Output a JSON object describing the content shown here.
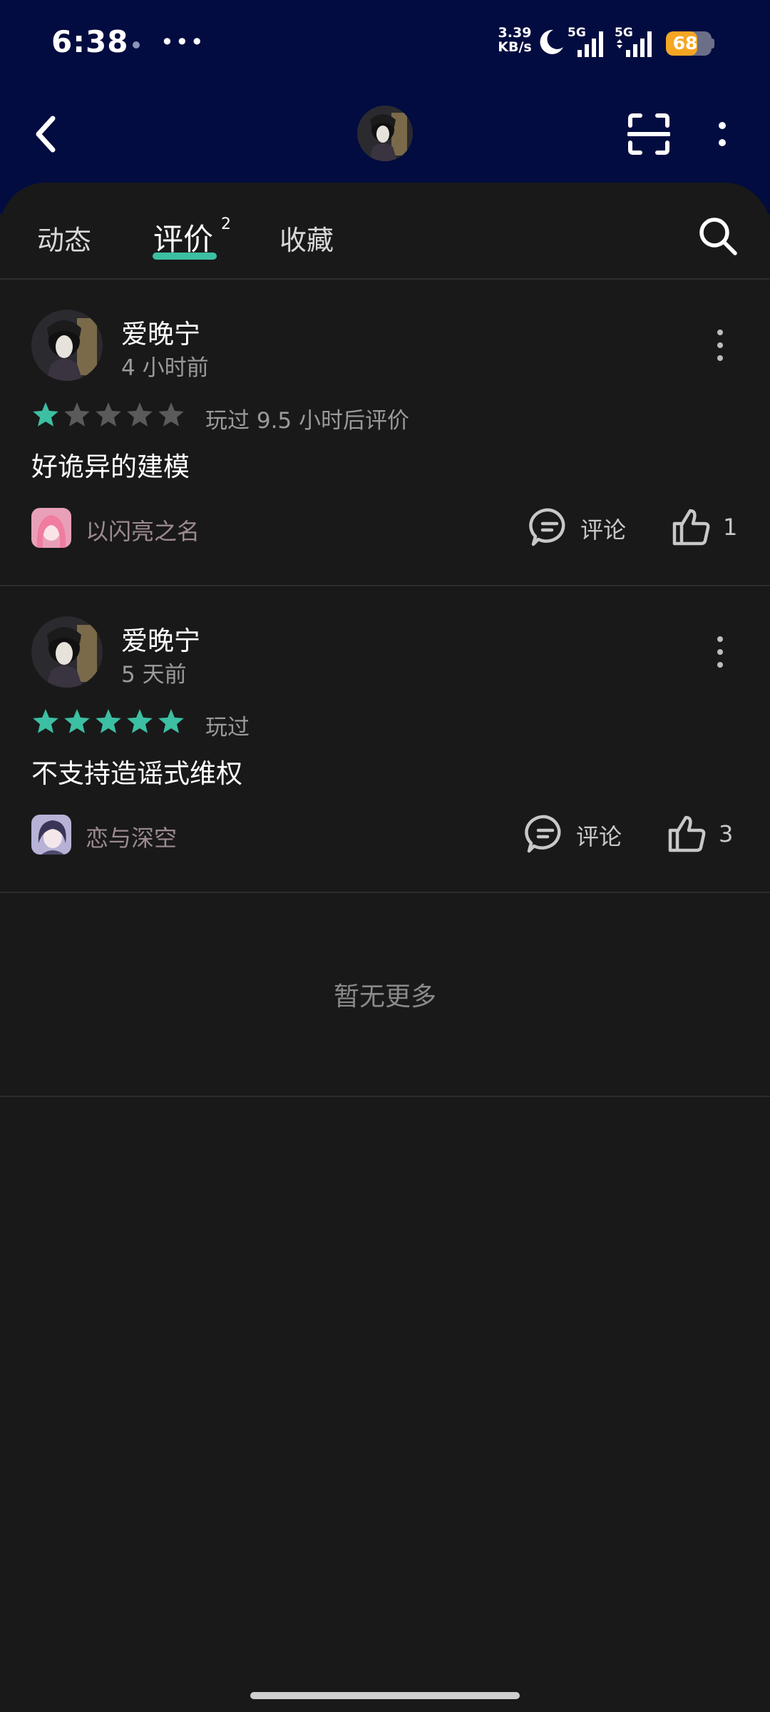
{
  "status_bar": {
    "time": "6:38",
    "speed_value": "3.39",
    "speed_unit": "KB/s",
    "sim1": "5G",
    "sim2": "5G",
    "battery": "68",
    "battery_level_percent": 68
  },
  "header": {
    "avatar_icon": "user-avatar",
    "scan_icon": "scan-icon",
    "more_icon": "more-vertical-icon"
  },
  "tabs": [
    {
      "label": "动态"
    },
    {
      "label": "评价",
      "badge": "2",
      "active": true
    },
    {
      "label": "收藏"
    }
  ],
  "reviews": [
    {
      "username": "爱晚宁",
      "time": "4 小时前",
      "rating": 1,
      "play_note": "玩过 9.5 小时后评价",
      "content": "好诡异的建模",
      "game": "以闪亮之名",
      "comment_label": "评论",
      "likes": "1"
    },
    {
      "username": "爱晚宁",
      "time": "5 天前",
      "rating": 5,
      "play_note": "玩过",
      "content": "不支持造谣式维权",
      "game": "恋与深空",
      "comment_label": "评论",
      "likes": "3"
    }
  ],
  "footer": {
    "no_more": "暂无更多"
  },
  "colors": {
    "header_bg": "#020c40",
    "panel_bg": "#191919",
    "accent": "#3cbfa3",
    "star_inactive": "#5a5a5a",
    "battery": "#f5a623"
  }
}
